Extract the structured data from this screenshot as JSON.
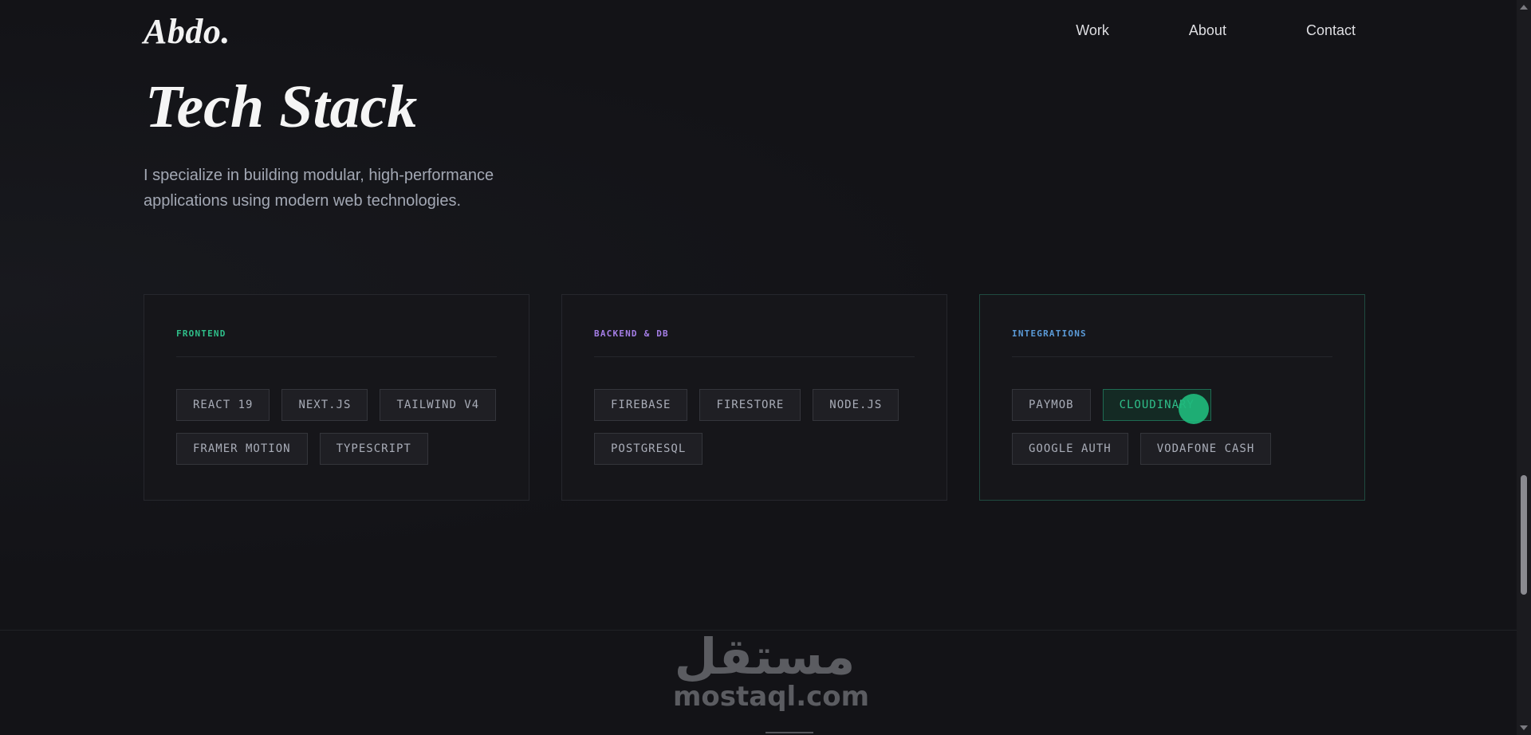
{
  "header": {
    "logo": "Abdo.",
    "nav": [
      "Work",
      "About",
      "Contact"
    ]
  },
  "hero": {
    "title": "Tech Stack",
    "subtitle": "I specialize in building modular, high-performance applications using modern web technologies."
  },
  "cards": [
    {
      "title": "FRONTEND",
      "accent": "#2fbf8a",
      "tags": [
        "REACT 19",
        "NEXT.JS",
        "TAILWIND V4",
        "FRAMER MOTION",
        "TYPESCRIPT"
      ]
    },
    {
      "title": "BACKEND & DB",
      "accent": "#a57ee6",
      "tags": [
        "FIREBASE",
        "FIRESTORE",
        "NODE.JS",
        "POSTGRESQL"
      ]
    },
    {
      "title": "INTEGRATIONS",
      "accent": "#5b9bd8",
      "tags": [
        "PAYMOB",
        "CLOUDINARY",
        "GOOGLE AUTH",
        "VODAFONE CASH"
      ],
      "active_tag": "CLOUDINARY"
    }
  ],
  "watermark": {
    "arabic": "مستقل",
    "latin": "mostaql.com"
  }
}
